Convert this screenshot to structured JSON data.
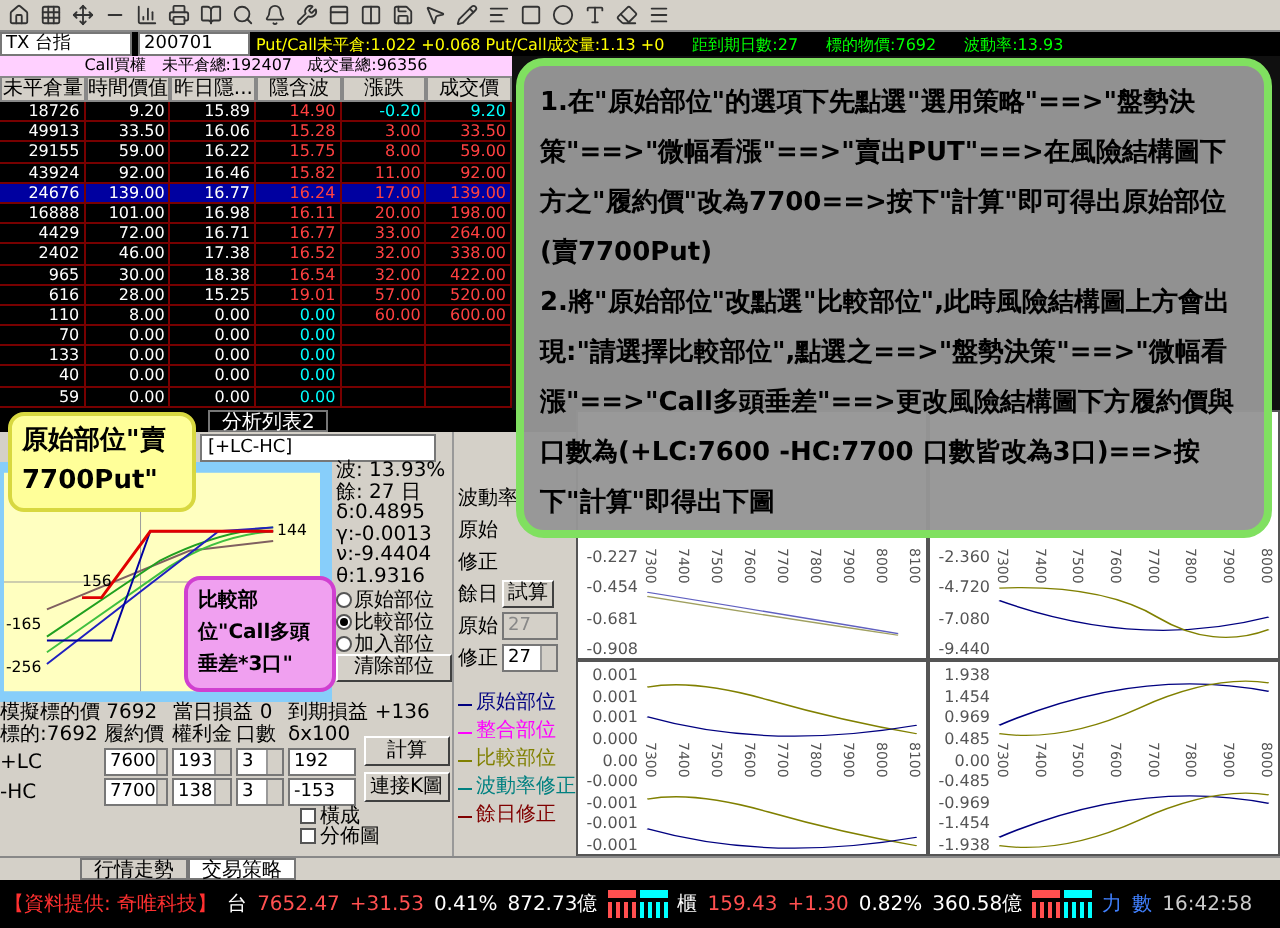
{
  "toolbar": {
    "symbol": "TX 台指",
    "month": "200701",
    "ratio_text": "Put/Call未平倉:1.022 +0.068  Put/Call成交量:1.13 +0"
  },
  "info_bar": [
    "距到期日數:27",
    "標的物價:7692",
    "波動率:13.93"
  ],
  "call_table": {
    "caption": "Call買權   未平倉總:192407   成交量總:96356",
    "columns": [
      "未平倉量",
      "時間價值",
      "昨日隱...",
      "隱含波",
      "漲跌",
      "成交價"
    ],
    "rows": [
      {
        "cells": [
          "18726",
          "9.20",
          "15.89",
          "14.90",
          "-0.20",
          "9.20"
        ],
        "selected": false
      },
      {
        "cells": [
          "49913",
          "33.50",
          "16.06",
          "15.28",
          "3.00",
          "33.50"
        ],
        "selected": false
      },
      {
        "cells": [
          "29155",
          "59.00",
          "16.22",
          "15.75",
          "8.00",
          "59.00"
        ],
        "selected": false
      },
      {
        "cells": [
          "43924",
          "92.00",
          "16.46",
          "15.82",
          "11.00",
          "92.00"
        ],
        "selected": false
      },
      {
        "cells": [
          "24676",
          "139.00",
          "16.77",
          "16.24",
          "17.00",
          "139.00"
        ],
        "selected": true
      },
      {
        "cells": [
          "16888",
          "101.00",
          "16.98",
          "16.11",
          "20.00",
          "198.00"
        ],
        "selected": false
      },
      {
        "cells": [
          "4429",
          "72.00",
          "16.71",
          "16.77",
          "33.00",
          "264.00"
        ],
        "selected": false
      },
      {
        "cells": [
          "2402",
          "46.00",
          "17.38",
          "16.52",
          "32.00",
          "338.00"
        ],
        "selected": false
      },
      {
        "cells": [
          "965",
          "30.00",
          "18.38",
          "16.54",
          "32.00",
          "422.00"
        ],
        "selected": false
      },
      {
        "cells": [
          "616",
          "28.00",
          "15.25",
          "19.01",
          "57.00",
          "520.00"
        ],
        "selected": false
      },
      {
        "cells": [
          "110",
          "8.00",
          "0.00",
          "0.00",
          "60.00",
          "600.00"
        ],
        "selected": false
      },
      {
        "cells": [
          "70",
          "0.00",
          "0.00",
          "0.00",
          "",
          ""
        ],
        "selected": false
      },
      {
        "cells": [
          "133",
          "0.00",
          "0.00",
          "0.00",
          "",
          ""
        ],
        "selected": false
      },
      {
        "cells": [
          "40",
          "0.00",
          "0.00",
          "0.00",
          "",
          ""
        ],
        "selected": false
      },
      {
        "cells": [
          "59",
          "0.00",
          "0.00",
          "0.00",
          "",
          ""
        ],
        "selected": false
      }
    ]
  },
  "callout": {
    "paragraphs": [
      "1.在\"原始部位\"的選項下先點選\"選用策略\"==>\"盤勢決策\"==>\"微幅看漲\"==>\"賣出PUT\"==>在風險結構圖下方之\"履約價\"改為7700==>按下\"計算\"即可得出原始部位(賣7700Put)",
      "2.將\"原始部位\"改點選\"比較部位\",此時風險結構圖上方會出現:\"請選擇比較部位\",點選之==>\"盤勢決策\"==>\"微幅看漲\"==>\"Call多頭垂差\"==>更改風險結構圖下方履約價與口數為(+LC:7600 -HC:7700 口數皆改為3口)==>按下\"計算\"即得出下圖"
    ]
  },
  "note_original": "原始部位\"賣7700Put\"",
  "note_compare": "比較部位\"Call多頭垂差*3口\"",
  "analysis_tabs": [
    {
      "label": "分析列表2",
      "selected": false
    }
  ],
  "strategy_select": {
    "value": "[+LC-HC]"
  },
  "risk_chart": {
    "labels": [
      "144",
      "156",
      "-165",
      "-256"
    ]
  },
  "greeks": [
    "波: 13.93%",
    "餘: 27 日",
    "δ:0.4895",
    "γ:-0.0013",
    "ν:-9.4404",
    "θ:1.9316"
  ],
  "position_options": [
    {
      "label": "原始部位",
      "selected": false
    },
    {
      "label": "比較部位",
      "selected": true
    },
    {
      "label": "加入部位",
      "selected": false
    }
  ],
  "clear_button": "清除部位",
  "simulation": [
    "模擬標的價 7692",
    "當日損益 0",
    "到期損益 +136"
  ],
  "legs": {
    "columns": [
      "標的:7692",
      "履約價",
      "權利金",
      "口數",
      "δx100"
    ],
    "rows": [
      {
        "label": "+LC",
        "strike": "7600",
        "premium": "193",
        "qty": "3",
        "delta": "192"
      },
      {
        "label": "-HC",
        "strike": "7700",
        "premium": "138",
        "qty": "3",
        "delta": "-153"
      }
    ]
  },
  "buttons": [
    "計算",
    "連接K圖"
  ],
  "checkboxes": [
    {
      "label": "橫成",
      "checked": false
    },
    {
      "label": "分佈圖",
      "checked": false
    }
  ],
  "adjust": {
    "vol_label": "波動率",
    "vol_rows": [
      "原始",
      "修正"
    ],
    "days_label": "餘日",
    "trial_button": "試算",
    "days_original_label": "原始",
    "days_original": "27",
    "days_modified_label": "修正",
    "days_modified": "27"
  },
  "legend": [
    {
      "label": "原始部位",
      "color": "#000080"
    },
    {
      "label": "整合部位",
      "color": "#ff00ff"
    },
    {
      "label": "比較部位",
      "color": "#808000"
    },
    {
      "label": "波動率修正",
      "color": "#008080"
    },
    {
      "label": "餘日修正",
      "color": "#800000"
    }
  ],
  "charts": [
    {
      "y_labels": [
        "-0.227",
        "-0.454",
        "-0.681",
        "-0.908"
      ],
      "x_labels": [
        "7300",
        "7400",
        "7500",
        "7600",
        "7700",
        "7800",
        "7900",
        "8000",
        "8100"
      ]
    },
    {
      "y_labels": [
        "-2.360",
        "-4.720",
        "-7.080",
        "-9.440"
      ],
      "x_labels": [
        "7300",
        "7400",
        "7500",
        "7600",
        "7700",
        "7800",
        "7900",
        "8000"
      ]
    },
    {
      "y_labels": [
        "0.001",
        "0.001",
        "0.001",
        "0.000",
        "0.00",
        "-0.000",
        "-0.001",
        "-0.001",
        "-0.001"
      ],
      "x_labels": [
        "7300",
        "7400",
        "7500",
        "7600",
        "7700",
        "7800",
        "7900",
        "8000",
        "8100"
      ]
    },
    {
      "y_labels": [
        "1.938",
        "1.454",
        "0.969",
        "0.485",
        "0.00",
        "-0.485",
        "-0.969",
        "-1.454",
        "-1.938"
      ],
      "x_labels": [
        "7300",
        "7400",
        "7500",
        "7600",
        "7700",
        "7800",
        "7900",
        "8000"
      ]
    }
  ],
  "bottom_tabs": [
    {
      "label": "行情走勢",
      "selected": false
    },
    {
      "label": "交易策略",
      "selected": true
    }
  ],
  "status_bar": {
    "source": "【資料提供: 奇唯科技】",
    "markets": [
      {
        "name": "台",
        "index": "7652.47",
        "change": "+31.53",
        "percent": "0.41%",
        "volume": "872.73億"
      },
      {
        "name": "櫃",
        "index": "159.43",
        "change": "+1.30",
        "percent": "0.82%",
        "volume": "360.58億"
      }
    ],
    "extra": [
      "力",
      "數"
    ],
    "time": "16:42:58"
  }
}
